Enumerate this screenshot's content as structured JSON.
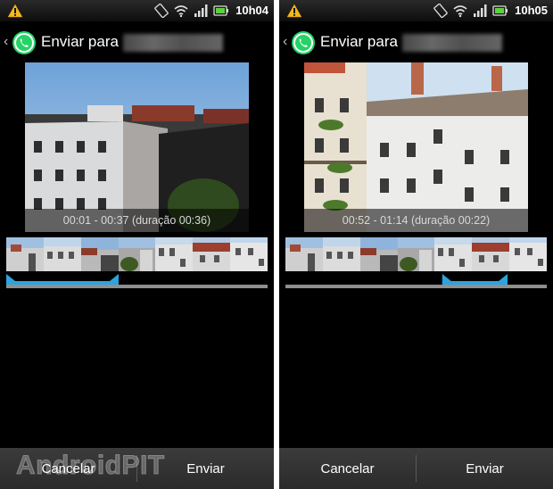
{
  "screens": [
    {
      "status_time": "10h04",
      "title": "Enviar para",
      "time_range": "00:01 - 00:37 (duração 00:36)",
      "selection": {
        "start_fraction": 0.0,
        "end_fraction": 0.43
      },
      "buttons": {
        "cancel": "Cancelar",
        "send": "Enviar"
      }
    },
    {
      "status_time": "10h05",
      "title": "Enviar para",
      "time_range": "00:52 - 01:14 (duração 00:22)",
      "selection": {
        "start_fraction": 0.6,
        "end_fraction": 0.85
      },
      "buttons": {
        "cancel": "Cancelar",
        "send": "Enviar"
      }
    }
  ],
  "icons": {
    "status_left": "warning-icon",
    "status_right": [
      "screen-rotation-icon",
      "wifi-icon",
      "signal-bars-icon",
      "battery-icon"
    ],
    "back": "chevron-left-icon",
    "app": "whatsapp-icon"
  },
  "colors": {
    "selection_accent": "#2ea3dd",
    "whatsapp_green": "#25d366",
    "background": "#000000"
  },
  "watermark": "AndroidPIT"
}
